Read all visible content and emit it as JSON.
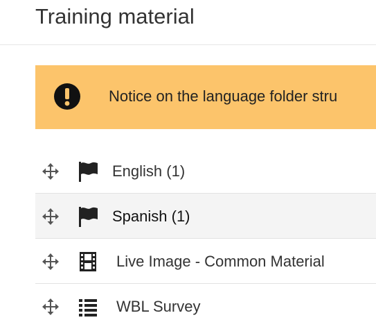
{
  "page": {
    "title": "Training material"
  },
  "notice": {
    "icon": "exclamation-circle-icon",
    "text": "Notice on the language folder stru",
    "color": "#fcc46b"
  },
  "items": [
    {
      "label": "English (1)",
      "icon": "flag-icon",
      "kind": "folder",
      "active": false
    },
    {
      "label": "Spanish (1)",
      "icon": "flag-icon",
      "kind": "folder",
      "active": true
    },
    {
      "label": "Live Image - Common Material",
      "icon": "film-icon",
      "kind": "video",
      "active": false
    },
    {
      "label": "WBL Survey",
      "icon": "list-icon",
      "kind": "survey",
      "active": false
    }
  ]
}
